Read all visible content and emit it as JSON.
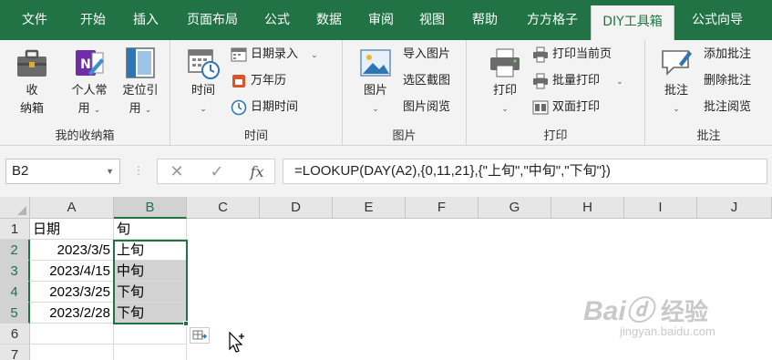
{
  "menu": {
    "tabs": [
      {
        "label": "文件"
      },
      {
        "label": "开始"
      },
      {
        "label": "插入"
      },
      {
        "label": "页面布局"
      },
      {
        "label": "公式"
      },
      {
        "label": "数据"
      },
      {
        "label": "审阅"
      },
      {
        "label": "视图"
      },
      {
        "label": "帮助"
      },
      {
        "label": "方方格子"
      },
      {
        "label": "DIY工具箱",
        "active": true
      },
      {
        "label": "公式向导"
      }
    ]
  },
  "ribbon": {
    "groups": [
      {
        "label": "我的收纳箱",
        "buttons": [
          {
            "label": "收",
            "label2": "纳箱",
            "icon": "toolbox-icon"
          },
          {
            "label": "个人常",
            "label2": "用",
            "icon": "personal-favorites-icon"
          },
          {
            "label": "定位引",
            "label2": "用",
            "icon": "locate-reference-icon"
          }
        ]
      },
      {
        "label": "时间",
        "big": {
          "label": "时间",
          "icon": "calendar-clock-icon"
        },
        "items": [
          {
            "label": "日期录入",
            "icon": "date-entry-icon"
          },
          {
            "label": "万年历",
            "icon": "perpetual-calendar-icon"
          },
          {
            "label": "日期时间",
            "icon": "clock-icon"
          }
        ]
      },
      {
        "label": "图片",
        "big": {
          "label": "图片",
          "icon": "picture-icon"
        },
        "items": [
          {
            "label": "导入图片"
          },
          {
            "label": "选区截图"
          },
          {
            "label": "图片阅览"
          }
        ]
      },
      {
        "label": "打印",
        "big": {
          "label": "打印",
          "icon": "printer-icon"
        },
        "items": [
          {
            "label": "打印当前页",
            "icon": "print-page-icon"
          },
          {
            "label": "批量打印",
            "icon": "batch-print-icon"
          },
          {
            "label": "双面打印",
            "icon": "duplex-print-icon"
          }
        ]
      },
      {
        "label": "批注",
        "big": {
          "label": "批注",
          "icon": "comment-icon"
        },
        "items": [
          {
            "label": "添加批注"
          },
          {
            "label": "删除批注"
          },
          {
            "label": "批注阅览"
          }
        ]
      }
    ]
  },
  "formula_bar": {
    "name_box": "B2",
    "cancel_symbol": "✕",
    "enter_symbol": "✓",
    "fx_label": "fx",
    "formula": "=LOOKUP(DAY(A2),{0,11,21},{\"上旬\",\"中旬\",\"下旬\"})"
  },
  "sheet": {
    "columns": [
      "A",
      "B",
      "C",
      "D",
      "E",
      "F",
      "G",
      "H",
      "I",
      "J"
    ],
    "selected_column": "B",
    "rows": [
      {
        "num": "1",
        "a": "日期",
        "b": "旬"
      },
      {
        "num": "2",
        "a": "2023/3/5",
        "b": "上旬"
      },
      {
        "num": "3",
        "a": "2023/4/15",
        "b": "中旬"
      },
      {
        "num": "4",
        "a": "2023/3/25",
        "b": "下旬"
      },
      {
        "num": "5",
        "a": "2023/2/28",
        "b": "下旬"
      },
      {
        "num": "6",
        "a": "",
        "b": ""
      },
      {
        "num": "7",
        "a": "",
        "b": ""
      }
    ]
  },
  "watermark": {
    "brand": "Bai",
    "brand2": "经验",
    "url": "jingyan.baidu.com"
  },
  "colors": {
    "excel_green": "#217346",
    "ribbon_bg": "#f3f3f3",
    "selection_fill": "#d2d2d2"
  }
}
